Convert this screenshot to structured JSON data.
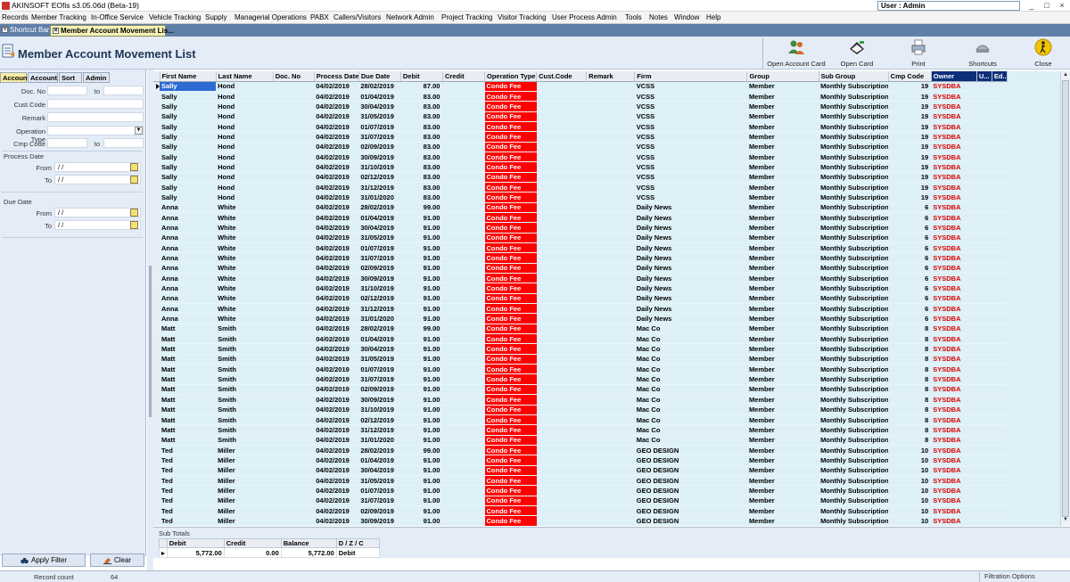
{
  "window": {
    "title": "AKINSOFT EOfis s3.05.06d (Beta-19)",
    "user": "User : Admin",
    "controls": [
      "_",
      "□",
      "×"
    ]
  },
  "menu": [
    "Records",
    "Member Tracking",
    "In-Office Service",
    "Vehicle Tracking",
    "Supply",
    "Managerial Operations",
    "PABX",
    "Callers/Visitors",
    "Network Admin",
    "Project Tracking",
    "Visitor Tracking",
    "User Process",
    "Admin",
    "Tools",
    "Notes",
    "Window",
    "Help"
  ],
  "tabs": [
    {
      "label": "Shortcut Bar",
      "active": false
    },
    {
      "label": "Member Account Movement Lis...",
      "active": true
    }
  ],
  "form": {
    "title": "Member Account Movement List",
    "toolbar": [
      {
        "label": "Open Account Card",
        "icon": "people-icon"
      },
      {
        "label": "Open Card",
        "icon": "card-icon"
      },
      {
        "label": "Print",
        "icon": "printer-icon"
      },
      {
        "label": "Shortcuts",
        "icon": "shortcuts-icon"
      },
      {
        "label": "Close",
        "icon": "close-person-icon"
      }
    ]
  },
  "filter": {
    "tabs": [
      "Account",
      "Account",
      "Sort",
      "Admin"
    ],
    "doc_no_label": "Doc. No",
    "to_label": "to",
    "cust_code_label": "Cust.Code",
    "remark_label": "Remark",
    "operation_type_label": "Operation Type",
    "cmp_code_label": "Cmp Code",
    "process_date_label": "Process Date",
    "due_date_label": "Due Date",
    "from_label": "From",
    "to2_label": "To",
    "date_placeholder": " / /",
    "apply_label": "Apply Filter",
    "clear_label": "Clear"
  },
  "grid": {
    "columns": [
      "First Name",
      "Last Name",
      "Doc. No",
      "Process Date",
      "Due Date",
      "Debit",
      "Credit",
      "Operation Type",
      "Cust.Code",
      "Remark",
      "Firm",
      "Group",
      "Sub Group",
      "Cmp Code",
      "Owner",
      "U...",
      "Ed..."
    ],
    "row_groups": [
      {
        "first": "Sally",
        "last": "Hond",
        "firm": "VCSS",
        "cmp": "19",
        "due_dates": [
          "28/02/2019",
          "01/04/2019",
          "30/04/2019",
          "31/05/2019",
          "01/07/2019",
          "31/07/2019",
          "02/09/2019",
          "30/09/2019",
          "31/10/2019",
          "02/12/2019",
          "31/12/2019",
          "31/01/2020"
        ],
        "debits": [
          "87.00",
          "83.00",
          "83.00",
          "83.00",
          "83.00",
          "83.00",
          "83.00",
          "83.00",
          "83.00",
          "83.00",
          "83.00",
          "83.00"
        ]
      },
      {
        "first": "Anna",
        "last": "White",
        "firm": "Daily News",
        "cmp": "6",
        "due_dates": [
          "28/02/2019",
          "01/04/2019",
          "30/04/2019",
          "31/05/2019",
          "01/07/2019",
          "31/07/2019",
          "02/09/2019",
          "30/09/2019",
          "31/10/2019",
          "02/12/2019",
          "31/12/2019",
          "31/01/2020"
        ],
        "debits": [
          "99.00",
          "91.00",
          "91.00",
          "91.00",
          "91.00",
          "91.00",
          "91.00",
          "91.00",
          "91.00",
          "91.00",
          "91.00",
          "91.00"
        ]
      },
      {
        "first": "Matt",
        "last": "Smith",
        "firm": "Mac Co",
        "cmp": "8",
        "due_dates": [
          "28/02/2019",
          "01/04/2019",
          "30/04/2019",
          "31/05/2019",
          "01/07/2019",
          "31/07/2019",
          "02/09/2019",
          "30/09/2019",
          "31/10/2019",
          "02/12/2019",
          "31/12/2019",
          "31/01/2020"
        ],
        "debits": [
          "99.00",
          "91.00",
          "91.00",
          "91.00",
          "91.00",
          "91.00",
          "91.00",
          "91.00",
          "91.00",
          "91.00",
          "91.00",
          "91.00"
        ]
      },
      {
        "first": "Ted",
        "last": "Miller",
        "firm": "GEO DESIGN",
        "cmp": "10",
        "due_dates": [
          "28/02/2019",
          "01/04/2019",
          "30/04/2019",
          "31/05/2019",
          "01/07/2019",
          "31/07/2019",
          "02/09/2019",
          "30/09/2019"
        ],
        "debits": [
          "99.00",
          "91.00",
          "91.00",
          "91.00",
          "91.00",
          "91.00",
          "91.00",
          "91.00"
        ]
      }
    ],
    "process_date": "04/02/2019",
    "operation_type": "Condo Fee",
    "group": "Member",
    "sub_group": "Monthly Subscription",
    "owner": "SYSDBA"
  },
  "subtotals": {
    "title": "Sub Totals",
    "headers": [
      "Debit",
      "Credit",
      "Balance",
      "D / Z / C"
    ],
    "values": [
      "5,772.00",
      "0.00",
      "5,772.00",
      "Debit"
    ]
  },
  "status": {
    "record_count_label": "Record count",
    "record_count": "64",
    "filtration": "Filtration Options"
  },
  "colors": {
    "operation_bg": "#ff0000",
    "owner_text": "#e00000",
    "grid_bg": "#ddf0f7",
    "selected_cell": "#2d6ad2"
  }
}
